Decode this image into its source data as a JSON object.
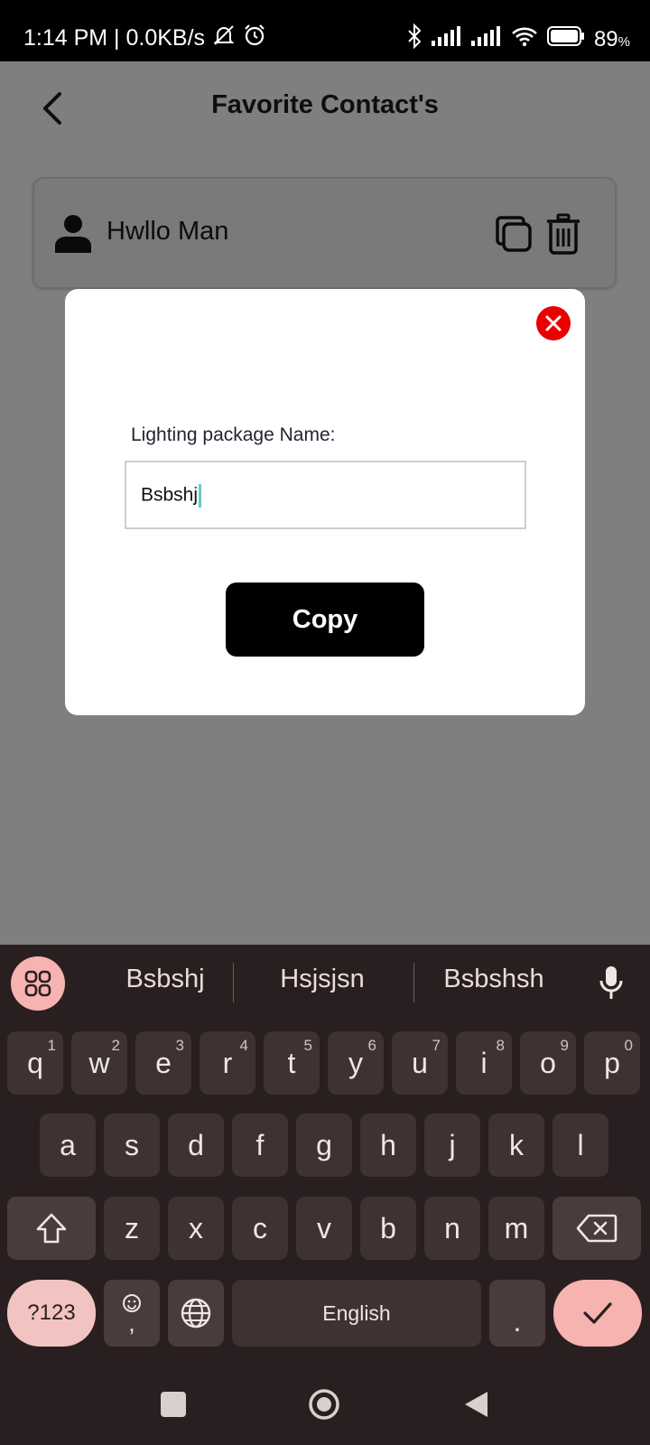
{
  "status_bar": {
    "time_speed": "1:14 PM | 0.0KB/s",
    "battery": "89",
    "battery_unit": "%",
    "icons": [
      "silent-bell-icon",
      "alarm-icon",
      "bluetooth-icon",
      "signal-icon",
      "signal-icon",
      "wifi-icon",
      "battery-icon"
    ]
  },
  "header": {
    "title": "Favorite Contact's",
    "back_icon": "back-arrow-icon"
  },
  "contact": {
    "name": "Hwllo Man",
    "icons": [
      "person-icon",
      "copy-icon",
      "trash-icon"
    ]
  },
  "dialog": {
    "label": "Lighting package Name:",
    "input_value": "Bsbshj",
    "button_label": "Copy",
    "close_icon": "close-icon",
    "close_color": "#ea0000"
  },
  "keyboard": {
    "suggestions": [
      "Bsbshj",
      "Hsjsjsn",
      "Bsbshsh"
    ],
    "row1": [
      {
        "key": "q",
        "hint": "1"
      },
      {
        "key": "w",
        "hint": "2"
      },
      {
        "key": "e",
        "hint": "3"
      },
      {
        "key": "r",
        "hint": "4"
      },
      {
        "key": "t",
        "hint": "5"
      },
      {
        "key": "y",
        "hint": "6"
      },
      {
        "key": "u",
        "hint": "7"
      },
      {
        "key": "i",
        "hint": "8"
      },
      {
        "key": "o",
        "hint": "9"
      },
      {
        "key": "p",
        "hint": "0"
      }
    ],
    "row2": [
      "a",
      "s",
      "d",
      "f",
      "g",
      "h",
      "j",
      "k",
      "l"
    ],
    "row3": [
      "z",
      "x",
      "c",
      "v",
      "b",
      "n",
      "m"
    ],
    "symbols_label": "?123",
    "comma_label": ",",
    "space_label": "English",
    "period_label": ".",
    "accent_color": "#f6b3b0"
  },
  "nav_bar": {
    "icons": [
      "recents-icon",
      "home-icon",
      "back-icon"
    ]
  }
}
